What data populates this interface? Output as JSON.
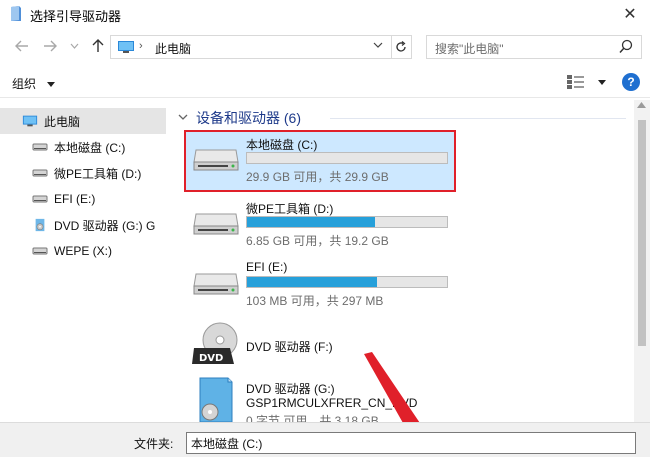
{
  "window": {
    "title": "选择引导驱动器",
    "close_glyph": "✕"
  },
  "address": {
    "crumb": "此电脑",
    "separator": "›"
  },
  "search": {
    "placeholder": "搜索\"此电脑\""
  },
  "toolbar": {
    "organize_label": "组织"
  },
  "nav": {
    "items": [
      {
        "label": "此电脑",
        "icon": "computer-icon",
        "selected": true
      },
      {
        "label": "本地磁盘 (C:)",
        "icon": "drive-icon"
      },
      {
        "label": "微PE工具箱 (D:)",
        "icon": "drive-icon"
      },
      {
        "label": "EFI (E:)",
        "icon": "drive-icon"
      },
      {
        "label": "DVD 驱动器 (G:) G",
        "icon": "dvd-icon"
      },
      {
        "label": "WEPE (X:)",
        "icon": "drive-icon"
      }
    ]
  },
  "main": {
    "group_title": "设备和驱动器 (6)",
    "drives": [
      {
        "name": "本地磁盘 (C:)",
        "size_text": "29.9 GB 可用，共 29.9 GB",
        "used_fraction": 0.0,
        "selected": true
      },
      {
        "name": "微PE工具箱 (D:)",
        "size_text": "6.85 GB 可用，共 19.2 GB",
        "used_fraction": 0.64
      },
      {
        "name": "EFI (E:)",
        "size_text": "103 MB 可用，共 297 MB",
        "used_fraction": 0.65
      }
    ],
    "dvds": [
      {
        "name": "DVD 驱动器 (F:)",
        "sub": "",
        "size_text": "",
        "disc_label": "DVD"
      },
      {
        "name": "DVD 驱动器 (G:)",
        "sub": "GSP1RMCULXFRER_CN_DVD",
        "size_text": "0 字节 可用，共 3.18 GB"
      }
    ]
  },
  "footer": {
    "folder_label": "文件夹:",
    "folder_value": "本地磁盘 (C:)"
  },
  "colors": {
    "accent": "#26a0da",
    "selection": "#cde8ff",
    "highlight_border": "#e0202a",
    "help": "#1f6fd0"
  }
}
